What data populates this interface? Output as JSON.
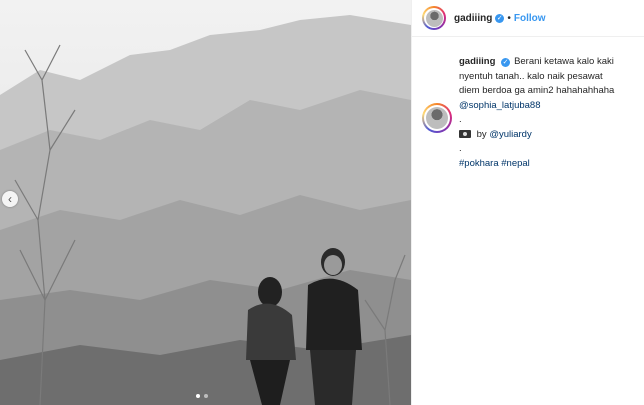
{
  "post": {
    "username": "gadiiing",
    "separator": "•",
    "follow_label": "Follow",
    "caption_lines": [
      "Berani ketawa kalo kaki",
      "nyentuh tanah.. kalo naik pesawat",
      "diem berdoa ga amin2 hahahahhaha"
    ],
    "mention": "@sophia_latjuba88",
    "dot1": ".",
    "by_label": "by",
    "credit": "@yuliardy",
    "dot2": ".",
    "hashtags": [
      "#pokhara",
      "#nepal"
    ]
  },
  "carousel": {
    "prev_glyph": "‹",
    "dot_count": 2,
    "active_index": 0
  },
  "colors": {
    "link": "#003569",
    "follow": "#3897f0",
    "verified": "#3897f0"
  },
  "icons": {
    "verified": "verified-badge-icon",
    "camera": "camera-emoji-icon",
    "prev": "chevron-left-icon"
  }
}
